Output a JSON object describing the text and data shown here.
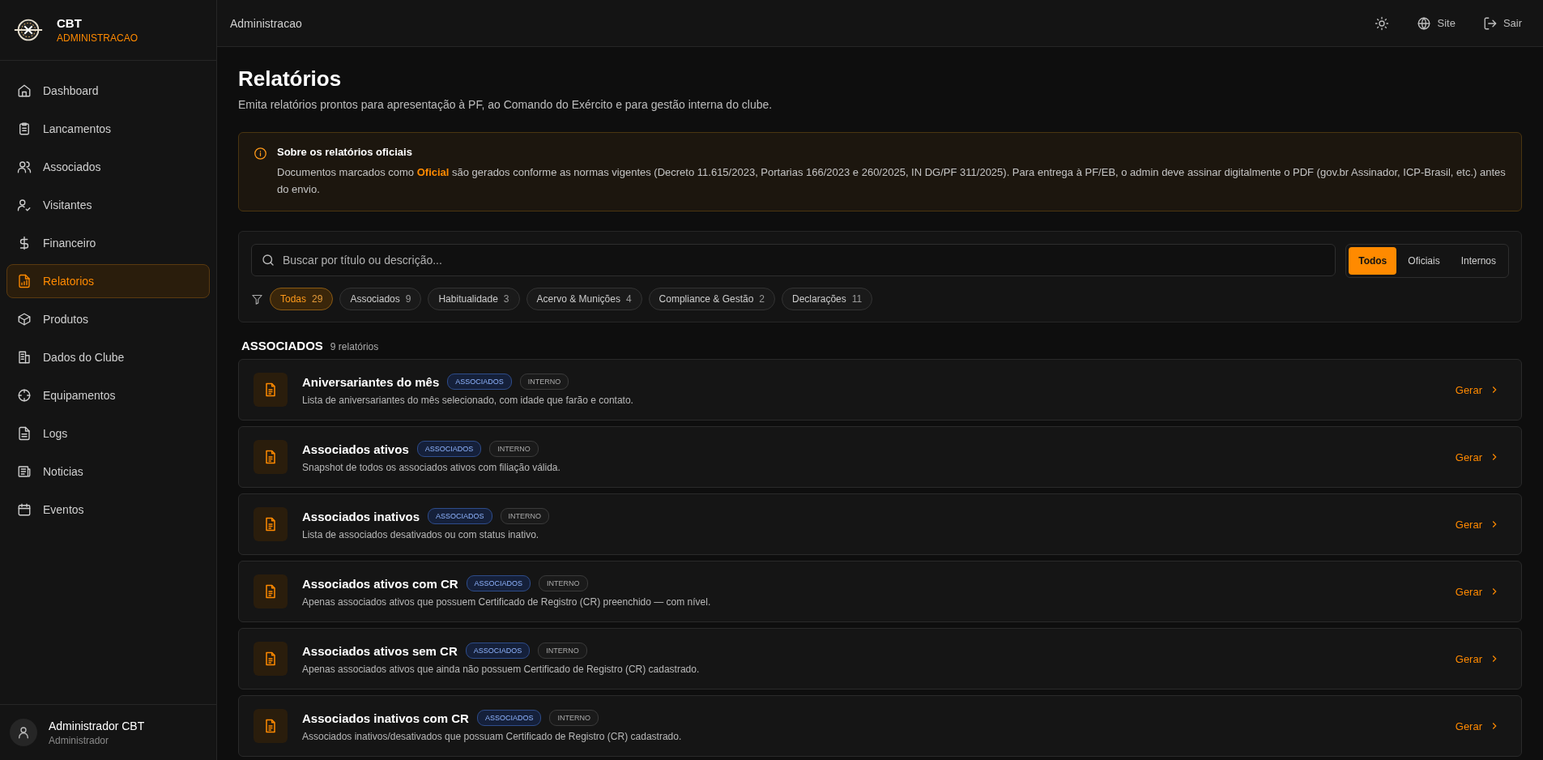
{
  "brand": {
    "name": "CBT",
    "subtitle": "ADMINISTRACAO"
  },
  "nav": [
    {
      "label": "Dashboard",
      "selected": false
    },
    {
      "label": "Lancamentos",
      "selected": false
    },
    {
      "label": "Associados",
      "selected": false
    },
    {
      "label": "Visitantes",
      "selected": false
    },
    {
      "label": "Financeiro",
      "selected": false
    },
    {
      "label": "Relatorios",
      "selected": true
    },
    {
      "label": "Produtos",
      "selected": false
    },
    {
      "label": "Dados do Clube",
      "selected": false
    },
    {
      "label": "Equipamentos",
      "selected": false
    },
    {
      "label": "Logs",
      "selected": false
    },
    {
      "label": "Noticias",
      "selected": false
    },
    {
      "label": "Eventos",
      "selected": false
    }
  ],
  "user": {
    "name": "Administrador CBT",
    "role": "Administrador"
  },
  "topbar": {
    "title": "Administracao",
    "site": "Site",
    "logout": "Sair"
  },
  "page": {
    "title": "Relatórios",
    "subtitle": "Emita relatórios prontos para apresentação à PF, ao Comando do Exército e para gestão interna do clube."
  },
  "notice": {
    "title": "Sobre os relatórios oficiais",
    "text": "Documentos marcados como **Oficial** são gerados conforme as normas vigentes (Decreto 11.615/2023, Portarias 166/2023 e 260/2025, IN DG/PF 311/2025). Para entrega à PF/EB, o admin deve assinar digitalmente o PDF (gov.br Assinador, ICP-Brasil, etc.) antes do envio."
  },
  "filters": {
    "placeholder": "Buscar por título ou descrição...",
    "scopes": [
      {
        "label": "Todos",
        "selected": true
      },
      {
        "label": "Oficiais",
        "selected": false
      },
      {
        "label": "Internos",
        "selected": false
      }
    ],
    "categories": [
      {
        "label": "Todas",
        "count": "29",
        "selected": true
      },
      {
        "label": "Associados",
        "count": "9",
        "selected": false
      },
      {
        "label": "Habitualidade",
        "count": "3",
        "selected": false
      },
      {
        "label": "Acervo & Munições",
        "count": "4",
        "selected": false
      },
      {
        "label": "Compliance & Gestão",
        "count": "2",
        "selected": false
      },
      {
        "label": "Declarações",
        "count": "11",
        "selected": false
      }
    ]
  },
  "section": {
    "title": "ASSOCIADOS",
    "count": "9 relatórios"
  },
  "reports": [
    {
      "title": "Aniversariantes do mês",
      "tags": [
        {
          "label": "ASSOCIADOS",
          "kind": "category"
        },
        {
          "label": "INTERNO",
          "kind": "scope"
        }
      ],
      "description": "Lista de aniversariantes do mês selecionado, com idade que farão e contato.",
      "action": "Gerar"
    },
    {
      "title": "Associados ativos",
      "tags": [
        {
          "label": "ASSOCIADOS",
          "kind": "category"
        },
        {
          "label": "INTERNO",
          "kind": "scope"
        }
      ],
      "description": "Snapshot de todos os associados ativos com filiação válida.",
      "action": "Gerar"
    },
    {
      "title": "Associados inativos",
      "tags": [
        {
          "label": "ASSOCIADOS",
          "kind": "category"
        },
        {
          "label": "INTERNO",
          "kind": "scope"
        }
      ],
      "description": "Lista de associados desativados ou com status inativo.",
      "action": "Gerar"
    },
    {
      "title": "Associados ativos com CR",
      "tags": [
        {
          "label": "ASSOCIADOS",
          "kind": "category"
        },
        {
          "label": "INTERNO",
          "kind": "scope"
        }
      ],
      "description": "Apenas associados ativos que possuem Certificado de Registro (CR) preenchido — com nível.",
      "action": "Gerar"
    },
    {
      "title": "Associados ativos sem CR",
      "tags": [
        {
          "label": "ASSOCIADOS",
          "kind": "category"
        },
        {
          "label": "INTERNO",
          "kind": "scope"
        }
      ],
      "description": "Apenas associados ativos que ainda não possuem Certificado de Registro (CR) cadastrado.",
      "action": "Gerar"
    },
    {
      "title": "Associados inativos com CR",
      "tags": [
        {
          "label": "ASSOCIADOS",
          "kind": "category"
        },
        {
          "label": "INTERNO",
          "kind": "scope"
        }
      ],
      "description": "Associados inativos/desativados que possuam Certificado de Registro (CR) cadastrado.",
      "action": "Gerar"
    }
  ]
}
